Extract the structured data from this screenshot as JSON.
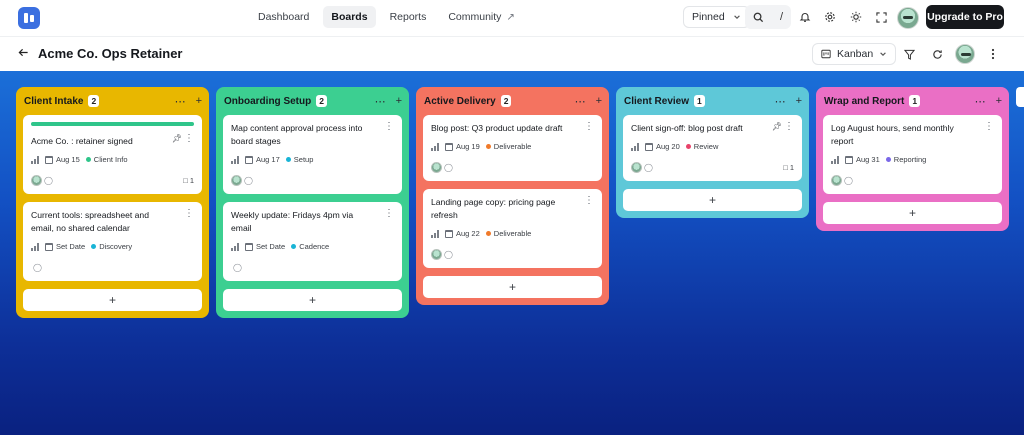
{
  "nav": {
    "items": [
      {
        "label": "Dashboard",
        "active": false
      },
      {
        "label": "Boards",
        "active": true
      },
      {
        "label": "Reports",
        "active": false
      },
      {
        "label": "Community",
        "active": false,
        "external": true
      }
    ],
    "pinned_label": "Pinned",
    "search_shortcut": "/",
    "upgrade_label": "Upgrade to Pro"
  },
  "board": {
    "title": "Acme Co. Ops Retainer",
    "view_label": "Kanban"
  },
  "lists": [
    {
      "title": "Client Intake",
      "count": "2",
      "color": "#e8b700",
      "cards": [
        {
          "title": "Acme Co. : retainer signed",
          "cover": "#2fc58a",
          "pinned": true,
          "date": "Aug 15",
          "tag": "Client Info",
          "tag_color": "#2fc58a",
          "comments": "1",
          "avatar": true
        },
        {
          "title": "Current tools: spreadsheet and email, no shared calendar",
          "date": "Set Date",
          "tag": "Discovery",
          "tag_color": "#19b4d6",
          "avatar": false
        }
      ]
    },
    {
      "title": "Onboarding Setup",
      "count": "2",
      "color": "#3ccf91",
      "cards": [
        {
          "title": "Map content approval process into board stages",
          "date": "Aug 17",
          "tag": "Setup",
          "tag_color": "#19b4d6",
          "avatar": true
        },
        {
          "title": "Weekly update: Fridays 4pm via email",
          "date": "Set Date",
          "tag": "Cadence",
          "tag_color": "#19b4d6",
          "avatar": false
        }
      ]
    },
    {
      "title": "Active Delivery",
      "count": "2",
      "color": "#f47360",
      "cards": [
        {
          "title": "Blog post: Q3 product update draft",
          "date": "Aug 19",
          "tag": "Deliverable",
          "tag_color": "#f07a2a",
          "avatar": true
        },
        {
          "title": "Landing page copy: pricing page refresh",
          "date": "Aug 22",
          "tag": "Deliverable",
          "tag_color": "#f07a2a",
          "avatar": true
        }
      ]
    },
    {
      "title": "Client Review",
      "count": "1",
      "color": "#5ec8d8",
      "cards": [
        {
          "title": "Client sign-off: blog post draft",
          "pinned": true,
          "date": "Aug 20",
          "tag": "Review",
          "tag_color": "#e8436a",
          "comments": "1",
          "avatar": true
        }
      ]
    },
    {
      "title": "Wrap and Report",
      "count": "1",
      "color": "#ea6fc5",
      "cards": [
        {
          "title": "Log August hours, send monthly report",
          "date": "Aug 31",
          "tag": "Reporting",
          "tag_color": "#7a68e8",
          "avatar": true
        }
      ]
    }
  ],
  "icons": {
    "back": "arrow-left-icon",
    "chevron": "chevron-down-icon",
    "search": "search-icon",
    "bell": "bell-icon",
    "settings": "gear-icon",
    "theme": "sun-icon",
    "fullscreen": "expand-icon",
    "filter": "filter-icon",
    "sync": "refresh-icon",
    "more": "more-icon"
  }
}
